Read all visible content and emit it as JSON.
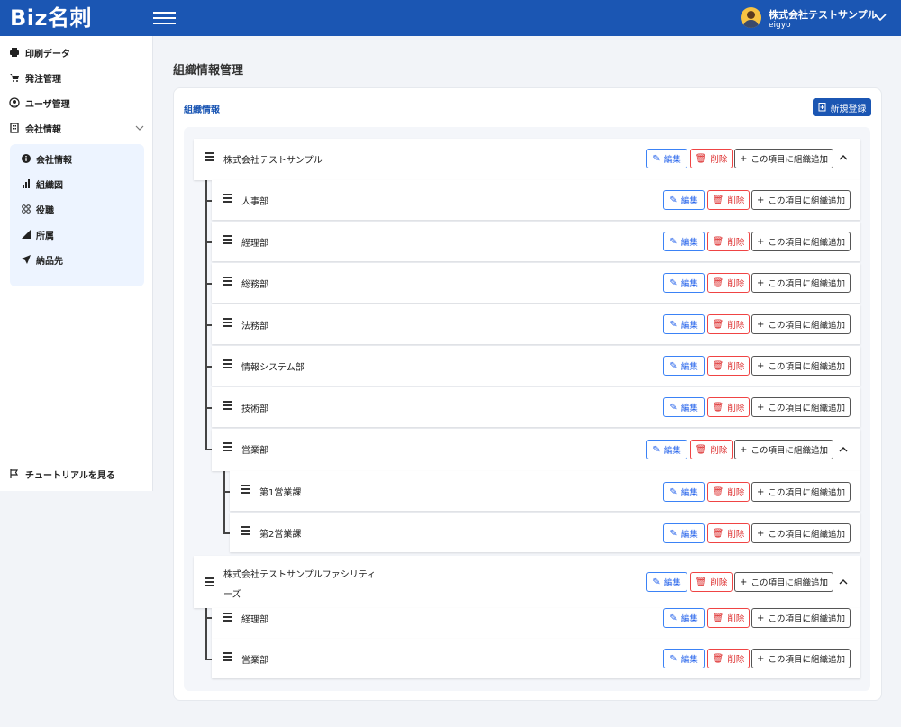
{
  "app": {
    "logo": "Biz名刺"
  },
  "user": {
    "company": "株式会社テストサンプル",
    "id": "eigyo"
  },
  "sidebar": {
    "items": [
      {
        "label": "印刷データ",
        "icon": "printer-icon"
      },
      {
        "label": "発注管理",
        "icon": "cart-icon"
      },
      {
        "label": "ユーザ管理",
        "icon": "user-circle-icon"
      },
      {
        "label": "会社情報",
        "icon": "building-icon"
      }
    ],
    "submenu": [
      {
        "label": "会社情報",
        "icon": "info-icon"
      },
      {
        "label": "組織図",
        "icon": "bar-chart-icon"
      },
      {
        "label": "役職",
        "icon": "grid-dots-icon"
      },
      {
        "label": "所属",
        "icon": "signal-icon"
      },
      {
        "label": "納品先",
        "icon": "send-icon"
      }
    ],
    "tutorial": "チュートリアルを見る"
  },
  "page": {
    "title": "組織情報管理",
    "section": "組織情報",
    "new_button": "新規登録",
    "edit_label": "編集",
    "delete_label": "削除",
    "add_label": "この項目に組織追加"
  },
  "tree": [
    {
      "label": "株式会社テストサンプル",
      "level": 0
    },
    {
      "label": "人事部",
      "level": 1
    },
    {
      "label": "経理部",
      "level": 1
    },
    {
      "label": "総務部",
      "level": 1
    },
    {
      "label": "法務部",
      "level": 1
    },
    {
      "label": "情報システム部",
      "level": 1
    },
    {
      "label": "技術部",
      "level": 1
    },
    {
      "label": "営業部",
      "level": 1
    },
    {
      "label": "第1営業課",
      "level": 2
    },
    {
      "label": "第2営業課",
      "level": 2
    },
    {
      "label_line1": "株式会社テストサンプルファシリティ",
      "label_line2": "ーズ",
      "level": 0
    },
    {
      "label": "経理部",
      "level": 1
    },
    {
      "label": "営業部",
      "level": 1
    }
  ],
  "colors": {
    "primary": "#1b56b3",
    "edit": "#2563eb",
    "delete": "#dc2626"
  }
}
